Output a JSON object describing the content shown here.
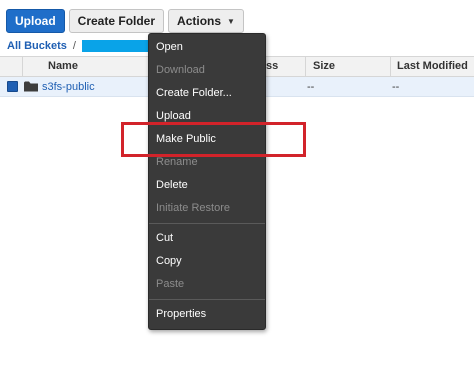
{
  "toolbar": {
    "upload_label": "Upload",
    "create_folder_label": "Create Folder",
    "actions_label": "Actions"
  },
  "breadcrumb": {
    "all_buckets": "All Buckets",
    "separator": "/"
  },
  "table": {
    "columns": [
      "Name",
      "Size",
      "Last Modified"
    ],
    "storage_class_fragment": "ss",
    "rows": [
      {
        "name": "s3fs-public",
        "size": "--",
        "last_modified": "--"
      }
    ]
  },
  "actions_menu": {
    "items": [
      {
        "label": "Open",
        "enabled": true
      },
      {
        "label": "Download",
        "enabled": false
      },
      {
        "label": "Create Folder...",
        "enabled": true
      },
      {
        "label": "Upload",
        "enabled": true
      },
      {
        "label": "Make Public",
        "enabled": true
      },
      {
        "label": "Rename",
        "enabled": false
      },
      {
        "label": "Delete",
        "enabled": true
      },
      {
        "label": "Initiate Restore",
        "enabled": false
      },
      {
        "label": "Cut",
        "enabled": true
      },
      {
        "label": "Copy",
        "enabled": true
      },
      {
        "label": "Paste",
        "enabled": false
      },
      {
        "label": "Properties",
        "enabled": true
      }
    ]
  },
  "colors": {
    "primary_button": "#1f6ec9",
    "link": "#1f5fb3",
    "redaction": "#09a3e8",
    "menu_background": "#3a3a3a",
    "highlight": "#d2232a",
    "selected_row": "#e9f1fb"
  },
  "icons": {
    "actions_caret": "chevron-down-icon",
    "folder": "folder-icon"
  }
}
